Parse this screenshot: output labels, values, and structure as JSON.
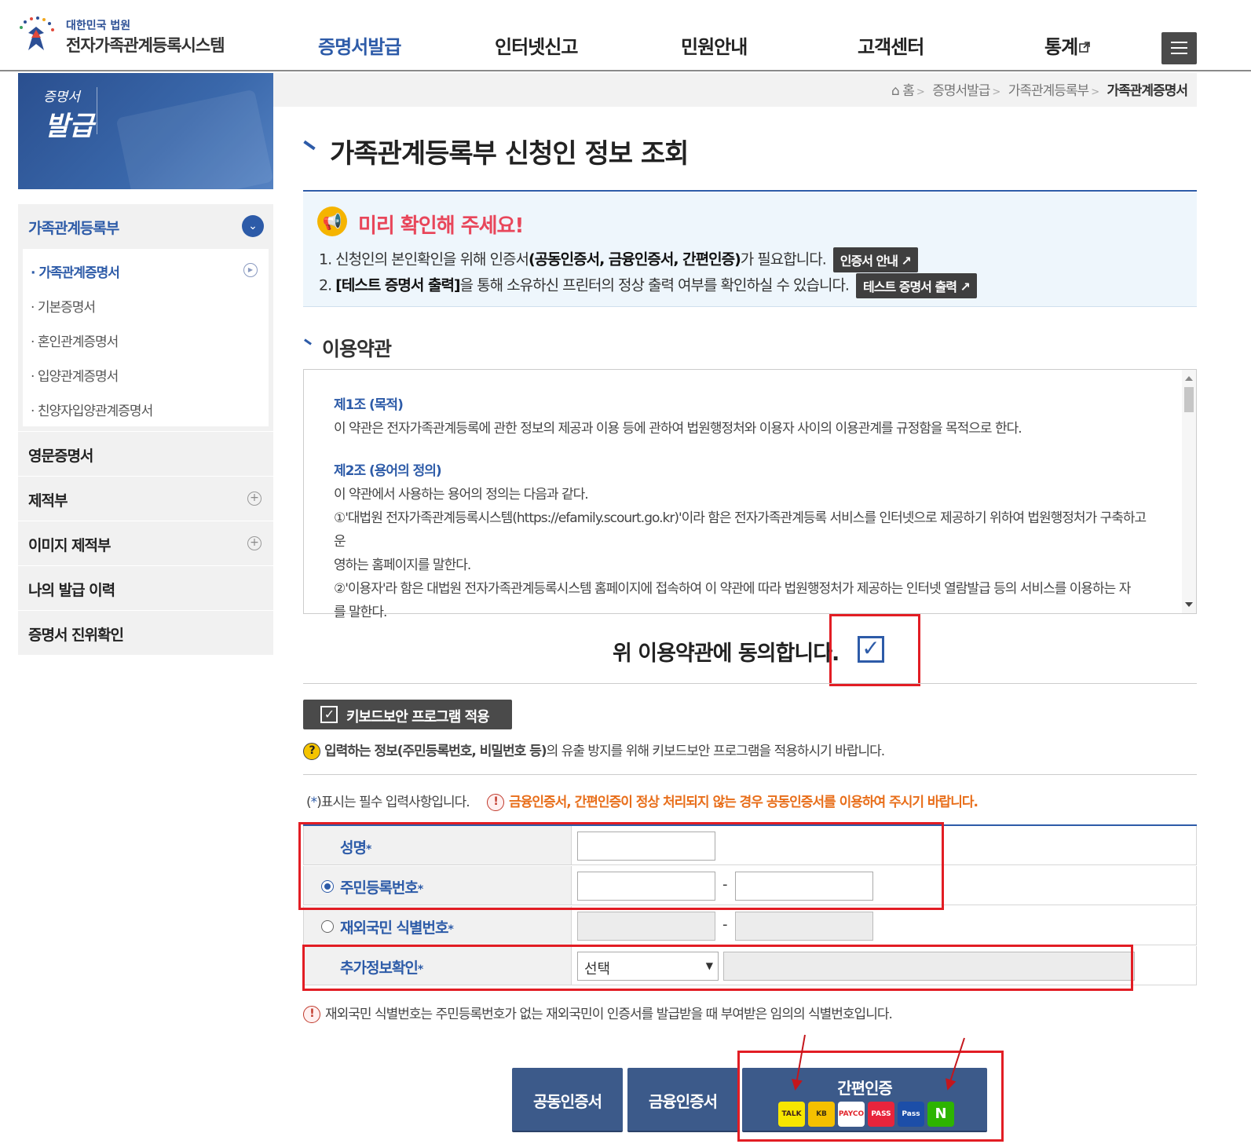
{
  "header": {
    "logo_sub": "대한민국 법원",
    "logo_main": "전자가족관계등록시스템",
    "nav": [
      {
        "label": "증명서발급",
        "active": true
      },
      {
        "label": "인터넷신고",
        "active": false
      },
      {
        "label": "민원안내",
        "active": false
      },
      {
        "label": "고객센터",
        "active": false
      },
      {
        "label": "통계",
        "active": false
      }
    ],
    "accent_color": "#2d5ba8"
  },
  "banner": {
    "line1": "증명서",
    "line2": "발급"
  },
  "sidebar": {
    "group": {
      "label": "가족관계등록부",
      "items": [
        "가족관계증명서",
        "기본증명서",
        "혼인관계증명서",
        "입양관계증명서",
        "친양자입양관계증명서"
      ]
    },
    "items": [
      {
        "label": "영문증명서",
        "expandable": false
      },
      {
        "label": "제적부",
        "expandable": true
      },
      {
        "label": "이미지 제적부",
        "expandable": true
      },
      {
        "label": "나의 발급 이력",
        "expandable": false
      },
      {
        "label": "증명서 진위확인",
        "expandable": false
      }
    ]
  },
  "breadcrumb": {
    "home": "홈",
    "items": [
      "증명서발급",
      "가족관계등록부"
    ],
    "current": "가족관계증명서"
  },
  "page_title": "가족관계등록부 신청인 정보 조회",
  "notice": {
    "title": "미리 확인해 주세요!",
    "line1_pre": "1. 신청인의 본인확인을 위해 인증서",
    "line1_bold": "(공동인증서, 금융인증서, 간편인증)",
    "line1_post": "가 필요합니다.",
    "line1_button": "인증서 안내",
    "line2_pre": "2. ",
    "line2_bold": "[테스트 증명서 출력]",
    "line2_post": "을 통해 소유하신 프린터의 정상 출력 여부를 확인하실 수 있습니다.",
    "line2_button": "테스트 증명서 출력"
  },
  "terms": {
    "section_title": "이용약관",
    "art1_title": "제1조 (목적)",
    "art1_body": "이 약관은 전자가족관계등록에 관한 정보의 제공과 이용 등에 관하여 법원행정처와 이용자 사이의 이용관계를 규정함을 목적으로 한다.",
    "art2_title": "제2조 (용어의 정의)",
    "art2_intro": "이 약관에서 사용하는 용어의 정의는 다음과 같다.",
    "art2_item1a": "①'대법원 전자가족관계등록시스템(https://efamily.scourt.go.kr)'이라 함은 전자가족관계등록 서비스를 인터넷으로 제공하기 위하여 법원행정처가 구축하고 운",
    "art2_item1b": "영하는 홈페이지를 말한다.",
    "art2_item2a": "②'이용자'라 함은 대법원 전자가족관계등록시스템 홈페이지에 접속하여 이 약관에 따라 법원행정처가 제공하는 인터넷 열람발급 등의 서비스를 이용하는 자",
    "art2_item2b": "를 말한다.",
    "agree_label": "위 이용약관에 동의합니다.",
    "agreed": true
  },
  "keyboard_security": {
    "button_label": "키보드보안 프로그램 적용",
    "help_bold": "입력하는 정보(주민등록번호, 비밀번호 등)",
    "help_rest": "의 유출 방지를 위해 키보드보안 프로그램을 적용하시기 바랍니다."
  },
  "form": {
    "required_pre": "(",
    "required_star": "*",
    "required_post": ")표시는 필수 입력사항입니다.",
    "warning": "금융인증서, 간편인증이 정상 처리되지 않는 경우 공동인증서를 이용하여 주시기 바랍니다.",
    "name_label": "성명",
    "rrn_label": "주민등록번호",
    "overseas_label": "재외국민 식별번호",
    "extra_label": "추가정보확인",
    "star": "*",
    "dash": "-",
    "select_value": "선택",
    "rrn_selected": true,
    "note": "재외국민 식별번호는 주민등록번호가 없는 재외국민이 인증서를 발급받을 때 부여받은 임의의 식별번호입니다."
  },
  "auth": {
    "joint_cert": "공동인증서",
    "financial_cert": "금융인증서",
    "simple_auth": "간편인증",
    "providers": [
      {
        "name": "TALK",
        "bg": "#f7e600",
        "fg": "#3c1e1e"
      },
      {
        "name": "KB",
        "bg": "#f5c000",
        "fg": "#3a2e12"
      },
      {
        "name": "PAYCO",
        "bg": "#ffffff",
        "fg": "#e1262d"
      },
      {
        "name": "PASS",
        "bg": "#e8243c",
        "fg": "#ffffff"
      },
      {
        "name": "Pass",
        "bg": "#1c4ea8",
        "fg": "#ffffff"
      },
      {
        "name": "N",
        "bg": "#2db400",
        "fg": "#ffffff"
      }
    ]
  }
}
